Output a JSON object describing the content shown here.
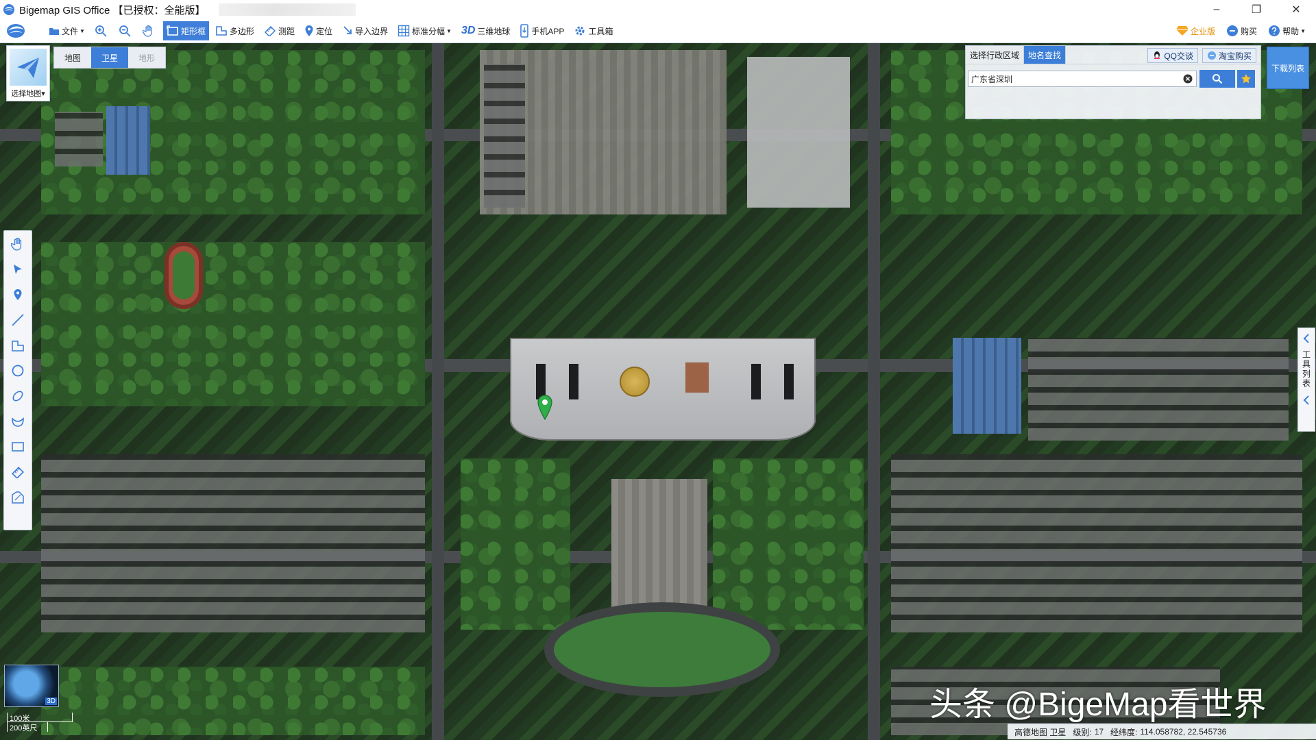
{
  "window": {
    "title": "Bigemap GIS Office 【已授权：全能版】",
    "minimize": "–",
    "restore": "❐",
    "close": "✕"
  },
  "toolbar": {
    "file": "文件",
    "rectangle": "矩形框",
    "polygon": "多边形",
    "measure": "测距",
    "locate": "定位",
    "import_boundary": "导入边界",
    "grid": "标准分幅",
    "three_d_mark": "3D",
    "globe": "三维地球",
    "mobile_app": "手机APP",
    "toolbox": "工具箱",
    "enterprise": "企业版",
    "buy": "购买",
    "help": "帮助"
  },
  "map_selector": {
    "choose_label": "选择地图",
    "tabs": [
      {
        "label": "地图",
        "state": "normal"
      },
      {
        "label": "卫星",
        "state": "active"
      },
      {
        "label": "地形",
        "state": "disabled"
      }
    ]
  },
  "search_panel": {
    "tab_region": "选择行政区域",
    "tab_place": "地名查找",
    "qq_link": "QQ交谈",
    "taobao_link": "淘宝购买",
    "input_value": "广东省深圳"
  },
  "download_list": "下载列表",
  "tool_list": "工具列表",
  "minimap": {
    "tag": "3D"
  },
  "scale": {
    "metric": "100米",
    "imperial": "200英尺"
  },
  "watermark": "头条 @BigeMap看世界",
  "status": {
    "source": "高德地图 卫星",
    "level_label": "级别:",
    "level_value": "17",
    "coord_label": "经纬度:",
    "coord_value": "114.058782, 22.545736"
  },
  "colors": {
    "accent": "#3d7fd8",
    "enterprise": "#e08a00"
  }
}
